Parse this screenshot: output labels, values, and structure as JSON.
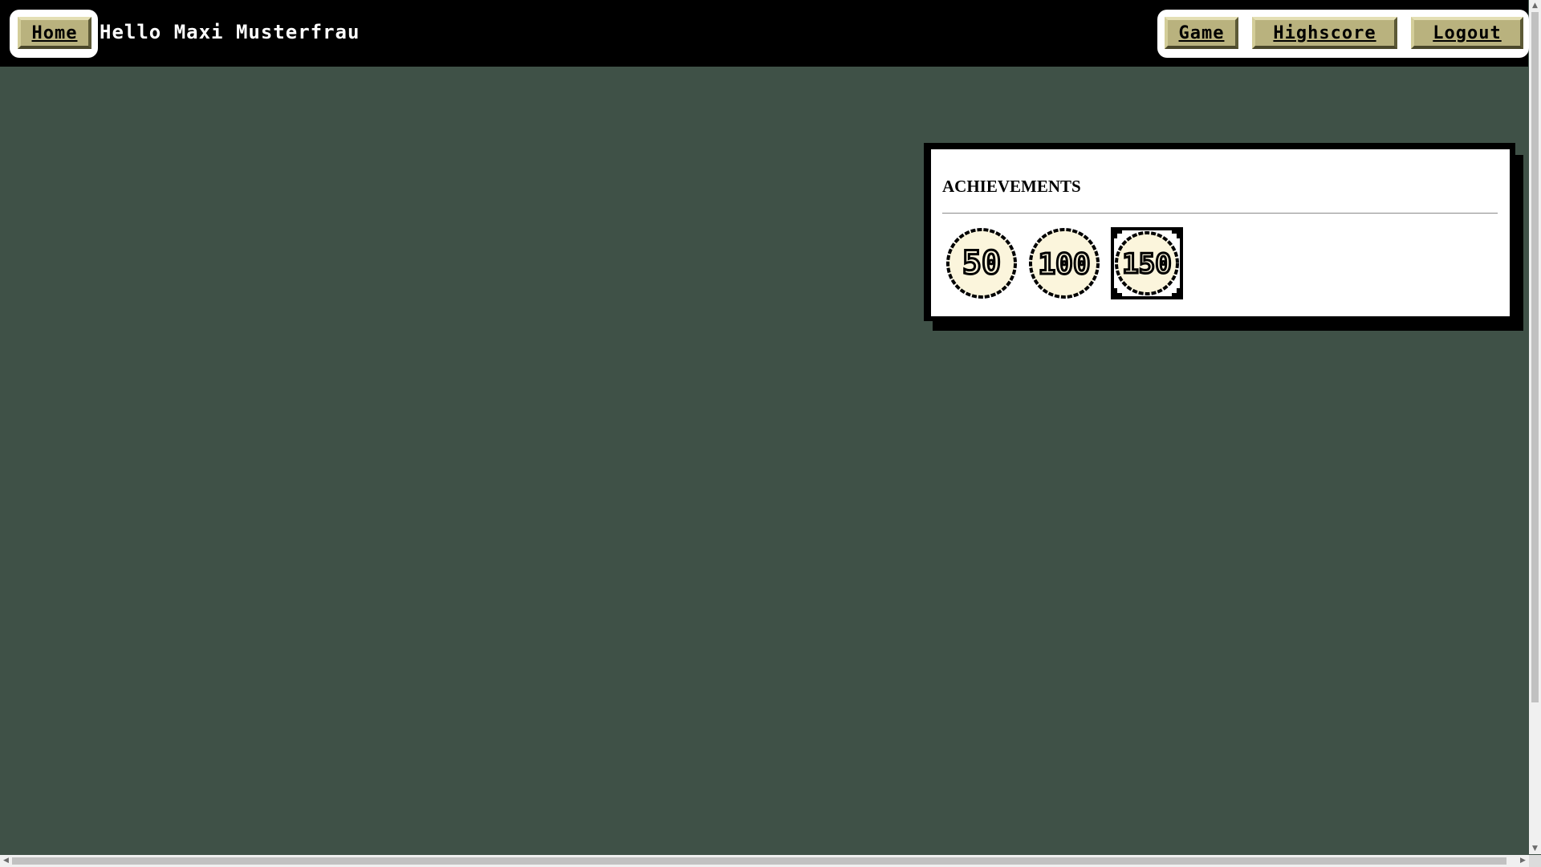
{
  "nav": {
    "home_label": "Home",
    "greeting": "Hello Maxi Musterfrau",
    "game_label": "Game",
    "highscore_label": "Highscore",
    "logout_label": "Logout"
  },
  "achievements": {
    "title": "ACHIEVEMENTS",
    "badges": [
      {
        "label": "50",
        "icon": "coin-50-icon",
        "selected": false
      },
      {
        "label": "100",
        "icon": "coin-100-icon",
        "selected": false
      },
      {
        "label": "150",
        "icon": "coin-150-icon",
        "selected": true
      }
    ]
  },
  "colors": {
    "background": "#3f5147",
    "topbar": "#000000",
    "button": "#b9b27e",
    "coin": "#fbf5dc"
  }
}
